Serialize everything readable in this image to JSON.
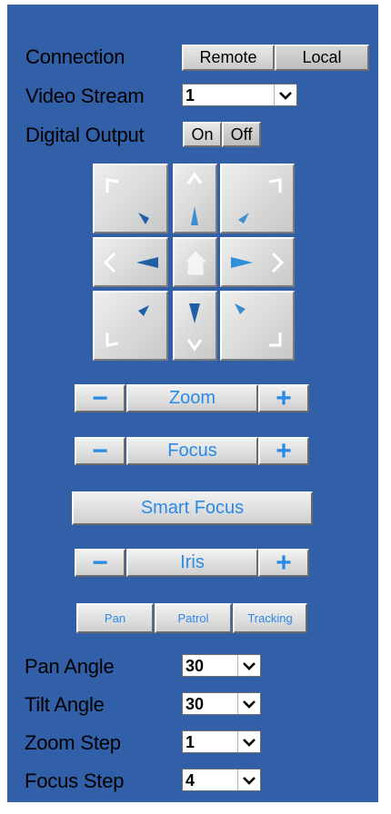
{
  "connection": {
    "label": "Connection",
    "remote": "Remote",
    "local": "Local"
  },
  "video_stream": {
    "label": "Video Stream",
    "value": "1"
  },
  "digital_output": {
    "label": "Digital Output",
    "on": "On",
    "off": "Off"
  },
  "zoom": {
    "label": "Zoom",
    "minus": "−",
    "plus": "+"
  },
  "focus": {
    "label": "Focus",
    "minus": "−",
    "plus": "+"
  },
  "smart_focus": {
    "label": "Smart Focus"
  },
  "iris": {
    "label": "Iris",
    "minus": "−",
    "plus": "+"
  },
  "modes": {
    "pan": "Pan",
    "patrol": "Patrol",
    "tracking": "Tracking"
  },
  "pan_angle": {
    "label": "Pan Angle",
    "value": "30"
  },
  "tilt_angle": {
    "label": "Tilt Angle",
    "value": "30"
  },
  "zoom_step": {
    "label": "Zoom Step",
    "value": "1"
  },
  "focus_step": {
    "label": "Focus Step",
    "value": "4"
  },
  "colors": {
    "panel": "#3260a8",
    "accent": "#2b8ae6",
    "button": "#d4d4d4"
  }
}
